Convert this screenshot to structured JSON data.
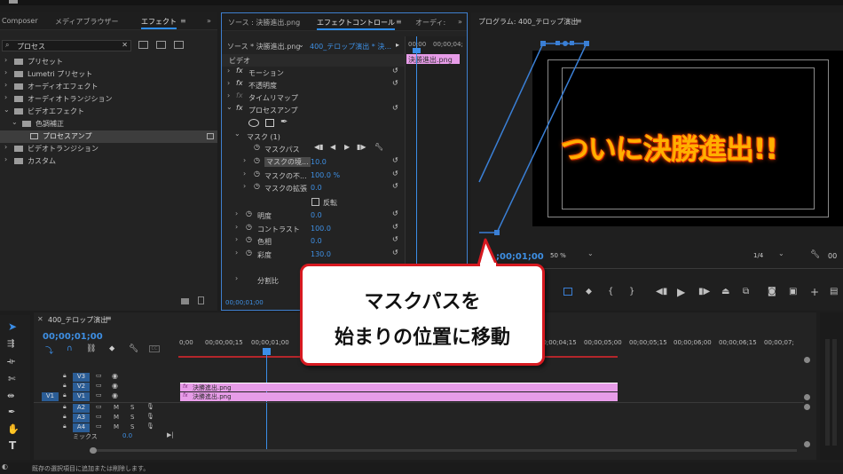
{
  "app_topbar": {},
  "project_panel": {
    "tabs": [
      "Composer",
      "メディアブラウザー",
      "エフェクト"
    ],
    "search_value": "プロセス",
    "tree": [
      {
        "label": "プリセット",
        "level": 0
      },
      {
        "label": "Lumetri プリセット",
        "level": 0
      },
      {
        "label": "オーディオエフェクト",
        "level": 0
      },
      {
        "label": "オーディオトランジション",
        "level": 0
      },
      {
        "label": "ビデオエフェクト",
        "level": 0
      },
      {
        "label": "色調補正",
        "level": 1
      },
      {
        "label": "プロセスアンプ",
        "level": 2
      },
      {
        "label": "ビデオトランジション",
        "level": 0
      },
      {
        "label": "カスタム",
        "level": 0
      }
    ]
  },
  "effect_controls": {
    "tab_source": "ソース : 決勝進出.png",
    "tab_active": "エフェクトコントロール",
    "tab_audio": "オーディ:",
    "source_line": "ソース * 決勝進出.png",
    "sequence_line": "400_テロップ演出 * 決...",
    "ruler_start": "00;00",
    "ruler_end": "00;00;04;",
    "clip_label": "決勝進出.png",
    "section_video": "ビデオ",
    "motion": "モーション",
    "opacity": "不透明度",
    "time_remap": "タイムリマップ",
    "proc_amp": "プロセスアンプ",
    "mask": "マスク (1)",
    "mask_path": "マスクパス",
    "mask_feather": "マスクの境...",
    "mask_feather_value": "10.0",
    "mask_opacity": "マスクの不...",
    "mask_opacity_value": "100.0 %",
    "mask_expansion": "マスクの拡張",
    "mask_expansion_value": "0.0",
    "inverted": "反転",
    "brightness": "明度",
    "brightness_value": "0.0",
    "contrast": "コントラスト",
    "contrast_value": "100.0",
    "hue": "色相",
    "hue_value": "0.0",
    "saturation": "彩度",
    "saturation_value": "130.0",
    "split": "分割比",
    "timecode": "00;00;01;00"
  },
  "program_monitor": {
    "title": "プログラム: 400_テロップ演出",
    "video_text": "ついに決勝進出!!",
    "timecode": ";00;01;00",
    "zoom": "50 %",
    "resolution": "1/4"
  },
  "callout": {
    "line1": "マスクパスを",
    "line2": "始まりの位置に移動"
  },
  "timeline": {
    "sequence_name": "400_テロップ演出",
    "timecode": "00;00;01;00",
    "ruler_labels": [
      "0;00",
      "00;00;00;15",
      "00;00;01;00",
      "00;00;04;15",
      "00;00;05;00",
      "00;00;05;15",
      "00;00;06;00",
      "00;00;06;15",
      "00;00;07;"
    ],
    "video_tracks": [
      "V3",
      "V2",
      "V1"
    ],
    "audio_tracks": [
      "A2",
      "A3",
      "A4"
    ],
    "source_patch_v": "V1",
    "mix_label": "ミックス",
    "mix_value": "0.0",
    "clip_label": "決勝進出.png"
  },
  "status_bar": {
    "text": "既存の選択項目に追加または削除します。"
  },
  "colors": {
    "accent_blue": "#2d8ceb",
    "clip_pink": "#e79ce8",
    "callout_red": "#d71920",
    "playhead": "#3b8ee8"
  }
}
